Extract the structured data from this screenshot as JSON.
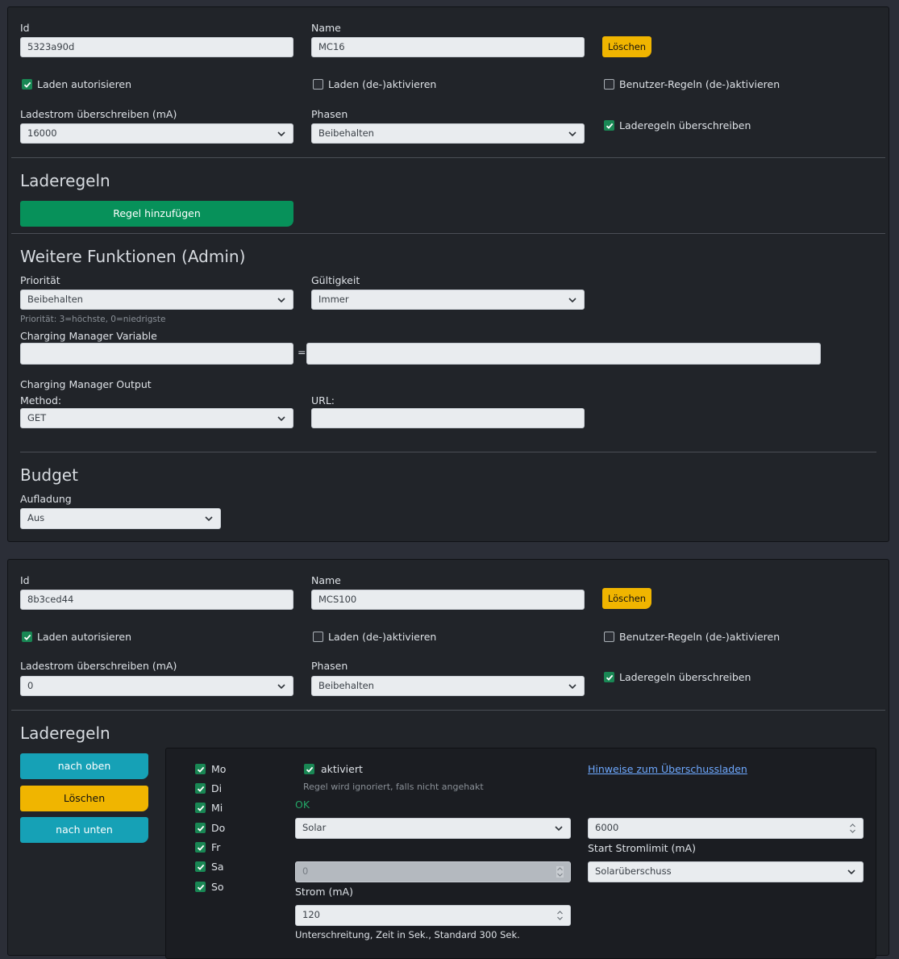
{
  "card1": {
    "id_label": "Id",
    "id_value": "5323a90d",
    "name_label": "Name",
    "name_value": "MC16",
    "delete_label": "Löschen",
    "authorize_label": "Laden autorisieren",
    "toggle_label": "Laden (de-)aktivieren",
    "user_rules_label": "Benutzer-Regeln (de-)aktivieren",
    "current_label": "Ladestrom überschreiben (mA)",
    "current_value": "16000",
    "phases_label": "Phasen",
    "phases_value": "Beibehalten",
    "override_label": "Laderegeln überschreiben",
    "rules_heading": "Laderegeln",
    "add_rule_label": "Regel hinzufügen",
    "admin_heading": "Weitere Funktionen (Admin)",
    "priority_label": "Priorität",
    "priority_value": "Beibehalten",
    "priority_hint": "Priorität: 3=höchste, 0=niedrigste",
    "validity_label": "Gültigkeit",
    "validity_value": "Immer",
    "cm_variable_label": "Charging Manager Variable",
    "equals": "=",
    "cm_output_label": "Charging Manager Output",
    "method_label": "Method:",
    "method_value": "GET",
    "url_label": "URL:",
    "budget_heading": "Budget",
    "charging_label": "Aufladung",
    "charging_value": "Aus"
  },
  "card2": {
    "id_label": "Id",
    "id_value": "8b3ced44",
    "name_label": "Name",
    "name_value": "MCS100",
    "delete_label": "Löschen",
    "authorize_label": "Laden autorisieren",
    "toggle_label": "Laden (de-)aktivieren",
    "user_rules_label": "Benutzer-Regeln (de-)aktivieren",
    "current_label": "Ladestrom überschreiben (mA)",
    "current_value": "0",
    "phases_label": "Phasen",
    "phases_value": "Beibehalten",
    "override_label": "Laderegeln überschreiben",
    "rules_heading": "Laderegeln",
    "up_label": "nach oben",
    "delete_rule_label": "Löschen",
    "down_label": "nach unten",
    "days": [
      "Mo",
      "Di",
      "Mi",
      "Do",
      "Fr",
      "Sa",
      "So"
    ],
    "activated_label": "aktiviert",
    "activated_hint": "Regel wird ignoriert, falls nicht angehakt",
    "status": "OK",
    "hint_link": "Hinweise zum Überschussladen",
    "mode_value": "Solar",
    "start_limit_value": "6000",
    "start_limit_label": "Start Stromlimit (mA)",
    "current_field_label": "Strom (mA)",
    "surplus_value": "Solarüberschuss",
    "undershoot_value": "120",
    "undershoot_label": "Unterschreitung, Zeit in Sek., Standard 300 Sek."
  },
  "colors": {
    "accent_green": "#198754",
    "warning_yellow": "#f0b500",
    "info_teal": "#16a1b6",
    "link_blue": "#6ea8fe"
  }
}
